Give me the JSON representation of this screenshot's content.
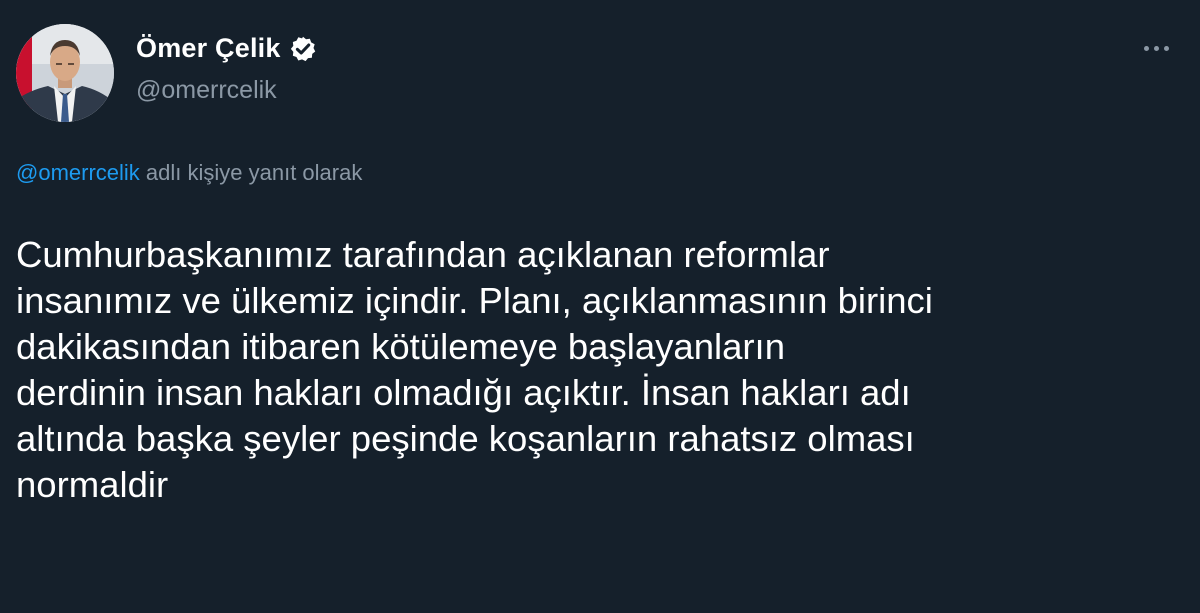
{
  "author": {
    "name": "Ömer Çelik",
    "handle": "@omerrcelik",
    "verified": true
  },
  "reply_context": {
    "mention": "@omerrcelik",
    "suffix": " adlı kişiye yanıt olarak"
  },
  "tweet": {
    "lines": [
      "Cumhurbaşkanımız tarafından açıklanan reformlar",
      "insanımız ve ülkemiz içindir. Planı, açıklanmasının birinci",
      "dakikasından itibaren kötülemeye başlayanların",
      "derdinin insan hakları olmadığı açıktır. İnsan hakları adı",
      "altında başka şeyler peşinde koşanların rahatsız olması",
      "normaldir"
    ]
  },
  "icons": {
    "verified_badge": "verified-badge-icon",
    "more": "more-icon",
    "flag": "turkish-flag"
  },
  "colors": {
    "background": "#15202b",
    "primary_text": "#ffffff",
    "secondary_text": "#8b98a5",
    "link": "#1d9bf0"
  }
}
